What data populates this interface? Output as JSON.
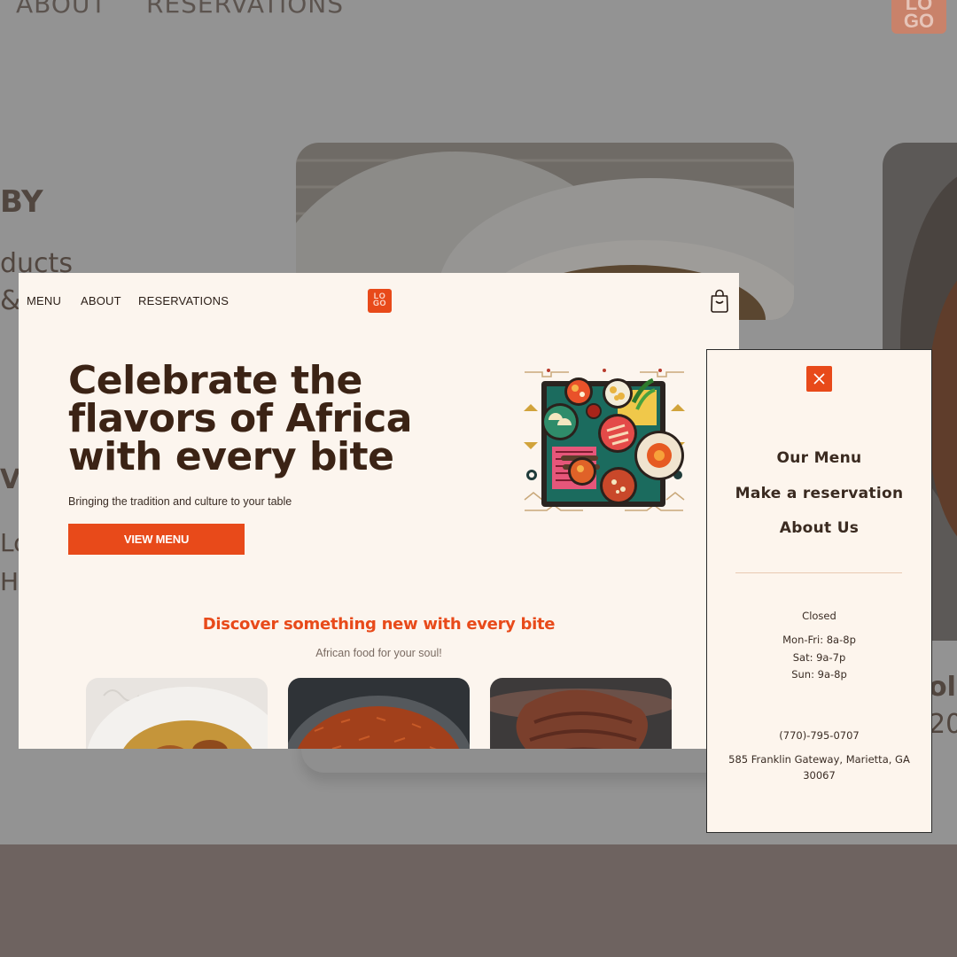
{
  "background": {
    "nav": [
      "ABOUT",
      "RESERVATIONS"
    ],
    "logo_text": "LO GO",
    "heading_fragment": "BY",
    "text_fragments": [
      "ducts",
      "&",
      "VA",
      "Lo",
      "Hi"
    ],
    "right_fragments": [
      "oll",
      "20"
    ]
  },
  "desktop": {
    "nav": {
      "menu": "MENU",
      "about": "ABOUT",
      "reservations": "RESERVATIONS"
    },
    "logo": {
      "line1": "LO",
      "line2": "GO"
    },
    "hero": {
      "title": "Celebrate the flavors of Africa with every bite",
      "subtitle": "Bringing the tradition and culture to your table",
      "cta": "VIEW MENU"
    },
    "discover": {
      "title": "Discover something new with every bite",
      "subtitle": "African food for your soul!"
    }
  },
  "mobile_menu": {
    "links": [
      "Our Menu",
      "Make a reservation",
      "About Us"
    ],
    "status": "Closed",
    "hours": [
      "Mon-Fri: 8a-8p",
      "Sat: 9a-7p",
      "Sun: 9a-8p"
    ],
    "phone": "(770)-795-0707",
    "address": "585 Franklin Gateway, Marietta, GA 30067"
  },
  "colors": {
    "accent": "#e84a1a",
    "cream": "#fcf5ee",
    "dark_brown": "#3b2315",
    "overlay_gray": "#939393",
    "footer": "#6e6360"
  },
  "icons": [
    "cart-bag-icon",
    "close-icon",
    "food-platter-illustration"
  ]
}
